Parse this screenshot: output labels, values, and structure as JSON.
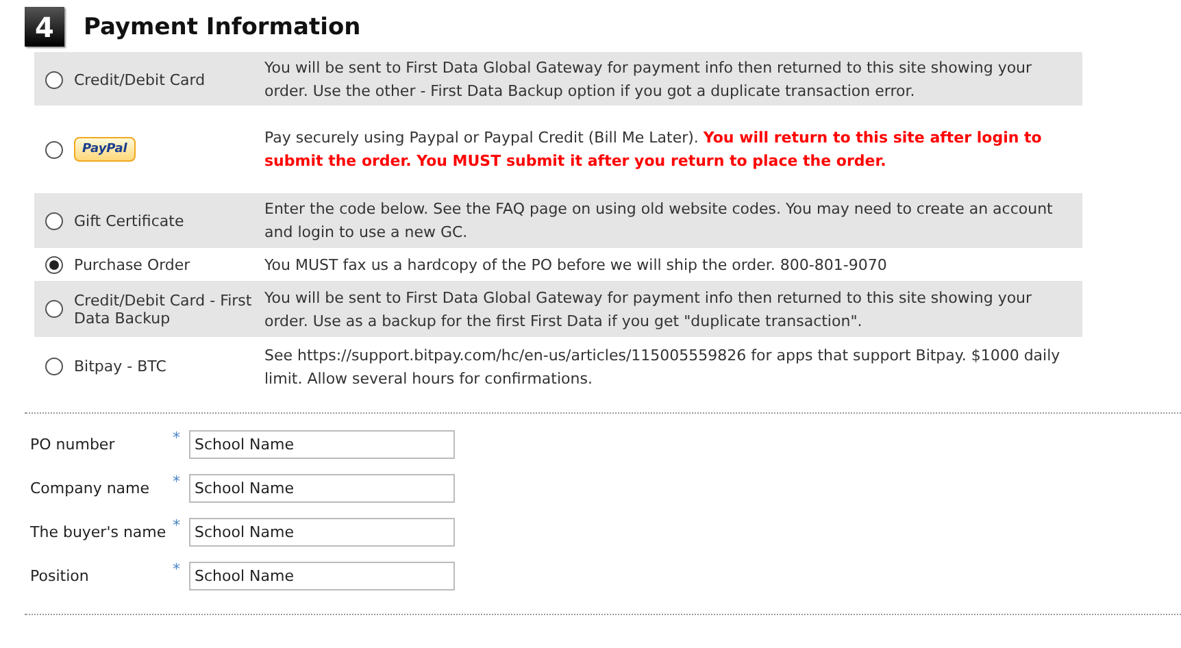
{
  "section": {
    "number": "4",
    "title": "Payment Information"
  },
  "payment_options": [
    {
      "kind": "text",
      "label": "Credit/Debit Card",
      "selected": false,
      "description": "You will be sent to First Data Global Gateway for payment info then returned to this site showing your order. Use the other - First Data Backup option if you got a duplicate transaction error."
    },
    {
      "kind": "logo",
      "label": "PayPal",
      "selected": false,
      "description": "Pay securely using Paypal or Paypal Credit (Bill Me Later). **You will return to this site after login to submit the order. You MUST submit it after you return to place the order.**"
    },
    {
      "kind": "text",
      "label": "Gift Certificate",
      "selected": false,
      "description": "Enter the code below. See the FAQ page on using old website codes. You may need to create an account and login to use a new GC."
    },
    {
      "kind": "text",
      "label": "Purchase Order",
      "selected": true,
      "description": "You MUST fax us a hardcopy of the PO before we will ship the order. 800-801-9070"
    },
    {
      "kind": "text",
      "label": "Credit/Debit Card - First Data Backup",
      "selected": false,
      "description": "You will be sent to First Data Global Gateway for payment info then returned to this site showing your order. Use as a backup for the first First Data if you get \"duplicate transaction\"."
    },
    {
      "kind": "text",
      "label": "Bitpay - BTC",
      "selected": false,
      "description": "See https://support.bitpay.com/hc/en-us/articles/115005559826 for apps that support Bitpay. $1000 daily limit. Allow several hours for confirmations."
    }
  ],
  "po_form": [
    {
      "label": "PO number",
      "required_mark": "*",
      "value": "School Name"
    },
    {
      "label": "Company name",
      "required_mark": "*",
      "value": "School Name"
    },
    {
      "label": "The buyer's name",
      "required_mark": "*",
      "value": "School Name"
    },
    {
      "label": "Position",
      "required_mark": "*",
      "value": "School Name"
    }
  ]
}
